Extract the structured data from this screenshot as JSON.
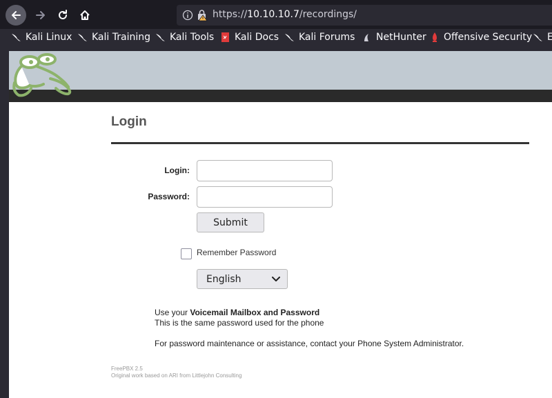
{
  "browser": {
    "url_prefix": "https://",
    "url_host": "10.10.10.7",
    "url_path": "/recordings/",
    "bookmarks": [
      {
        "label": "Kali Linux"
      },
      {
        "label": "Kali Training"
      },
      {
        "label": "Kali Tools"
      },
      {
        "label": "Kali Docs"
      },
      {
        "label": "Kali Forums"
      },
      {
        "label": "NetHunter"
      },
      {
        "label": "Offensive Security"
      },
      {
        "label": "E"
      }
    ]
  },
  "page": {
    "title": "Login",
    "login_label": "Login:",
    "password_label": "Password:",
    "login_value": "",
    "password_value": "",
    "submit_label": "Submit",
    "remember_label": "Remember Password",
    "language_selected": "English",
    "info_prefix": "Use your ",
    "info_bold": "Voicemail Mailbox and Password",
    "info_line2": "This is the same password used for the phone",
    "info_line3": "For password maintenance or assistance, contact your Phone System Administrator.",
    "footer_version": "FreePBX 2.5",
    "footer_credit": "Original work based on ARI from Littlejohn Consulting"
  },
  "colors": {
    "banner": "#c1cad2",
    "banner_dark": "#2a2a2a",
    "chrome_bg": "#1c1b22",
    "logo_green": "#8db36b"
  }
}
